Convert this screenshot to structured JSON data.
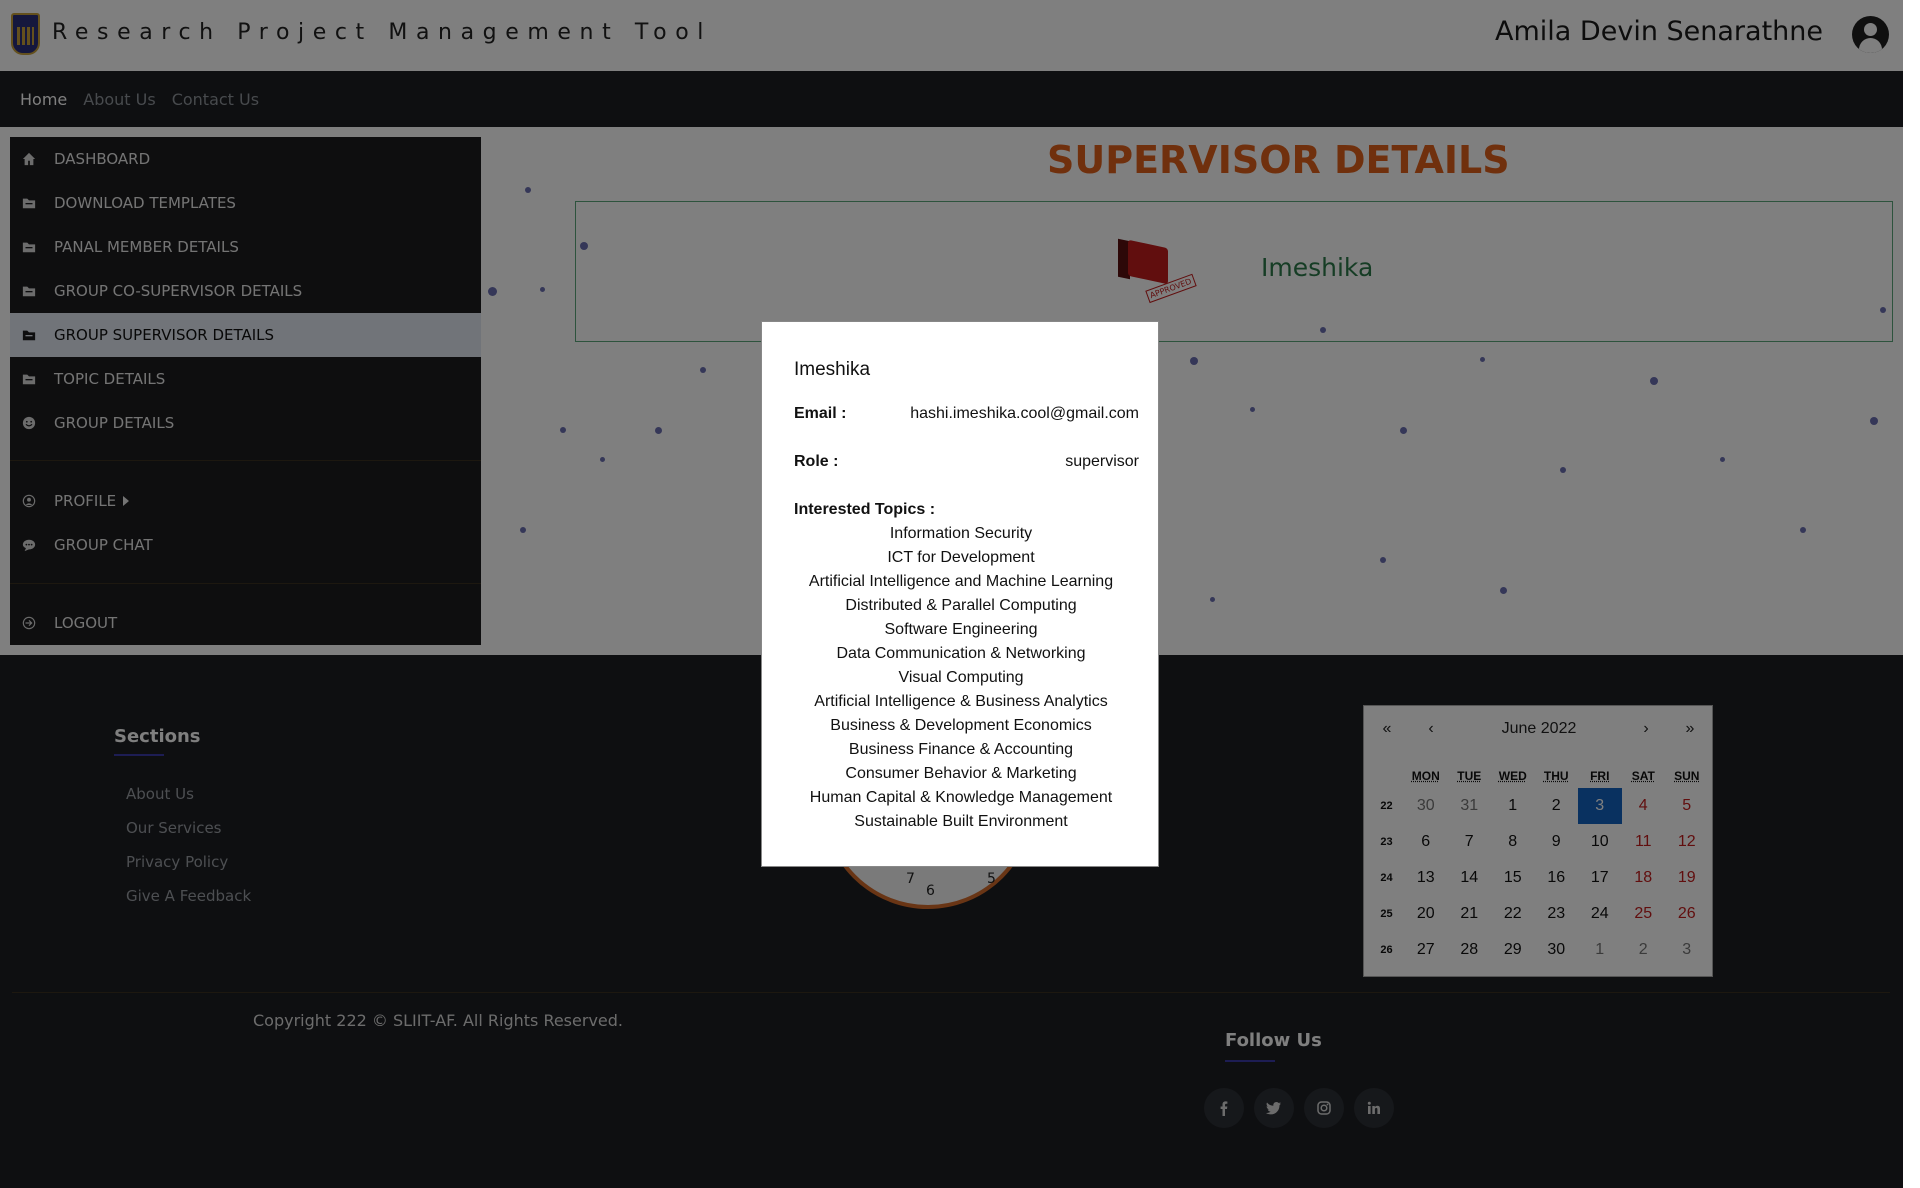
{
  "header": {
    "app_title": "Research Project Management Tool",
    "user_name": "Amila Devin Senarathne"
  },
  "nav": {
    "items": [
      "Home",
      "About Us",
      "Contact Us"
    ],
    "active": "Home"
  },
  "sidebar": {
    "items": [
      {
        "label": "DASHBOARD",
        "icon": "home-icon"
      },
      {
        "label": "DOWNLOAD TEMPLATES",
        "icon": "folder-icon"
      },
      {
        "label": "PANAL MEMBER DETAILS",
        "icon": "folder-icon"
      },
      {
        "label": "GROUP CO-SUPERVISOR DETAILS",
        "icon": "folder-icon"
      },
      {
        "label": "GROUP SUPERVISOR DETAILS",
        "icon": "folder-icon"
      },
      {
        "label": "TOPIC DETAILS",
        "icon": "folder-icon"
      },
      {
        "label": "GROUP DETAILS",
        "icon": "smile-icon"
      },
      {
        "label": "PROFILE",
        "icon": "user-circle-icon"
      },
      {
        "label": "GROUP CHAT",
        "icon": "chat-icon"
      },
      {
        "label": "LOGOUT",
        "icon": "logout-icon"
      }
    ],
    "active_index": 4
  },
  "main": {
    "page_title": "SUPERVISOR DETAILS",
    "card": {
      "name": "Imeshika",
      "stamp_text": "APPROVED"
    }
  },
  "modal": {
    "name": "Imeshika",
    "email_label": "Email :",
    "email": "hashi.imeshika.cool@gmail.com",
    "role_label": "Role :",
    "role": "supervisor",
    "topics_label": "Interested Topics :",
    "topics": [
      "Information Security",
      "ICT for Development",
      "Artificial Intelligence and Machine Learning",
      "Distributed & Parallel Computing",
      "Software Engineering",
      "Data Communication & Networking",
      "Visual Computing",
      "Artificial Intelligence & Business Analytics",
      "Business & Development Economics",
      "Business Finance & Accounting",
      "Consumer Behavior & Marketing",
      "Human Capital & Knowledge Management",
      "Sustainable Built Environment"
    ]
  },
  "footer": {
    "sections_title": "Sections",
    "links": [
      "About Us",
      "Our Services",
      "Privacy Policy",
      "Give A Feedback"
    ],
    "copyright": "Copyright 222 © SLIIT-AF. All Rights Reserved.",
    "follow_title": "Follow Us",
    "social": [
      "facebook-icon",
      "twitter-icon",
      "instagram-icon",
      "linkedin-icon"
    ]
  },
  "clock": {
    "visible_numbers": [
      "7",
      "6",
      "5"
    ]
  },
  "calendar": {
    "month_label": "June 2022",
    "nav": [
      "«",
      "‹",
      "›",
      "»"
    ],
    "weekdays": [
      "MON",
      "TUE",
      "WED",
      "THU",
      "FRI",
      "SAT",
      "SUN"
    ],
    "weeks": [
      {
        "wk": "22",
        "days": [
          "30",
          "31",
          "1",
          "2",
          "3",
          "4",
          "5"
        ]
      },
      {
        "wk": "23",
        "days": [
          "6",
          "7",
          "8",
          "9",
          "10",
          "11",
          "12"
        ]
      },
      {
        "wk": "24",
        "days": [
          "13",
          "14",
          "15",
          "16",
          "17",
          "18",
          "19"
        ]
      },
      {
        "wk": "25",
        "days": [
          "20",
          "21",
          "22",
          "23",
          "24",
          "25",
          "26"
        ]
      },
      {
        "wk": "26",
        "days": [
          "27",
          "28",
          "29",
          "30",
          "1",
          "2",
          "3"
        ]
      }
    ],
    "today": "3",
    "colors": {
      "today_bg": "#1362c0",
      "weekend": "#c21c1c"
    }
  },
  "colors": {
    "title_accent": "#e0601a",
    "card_name": "#2d7a4a",
    "dark_bg": "#1c1e22"
  }
}
